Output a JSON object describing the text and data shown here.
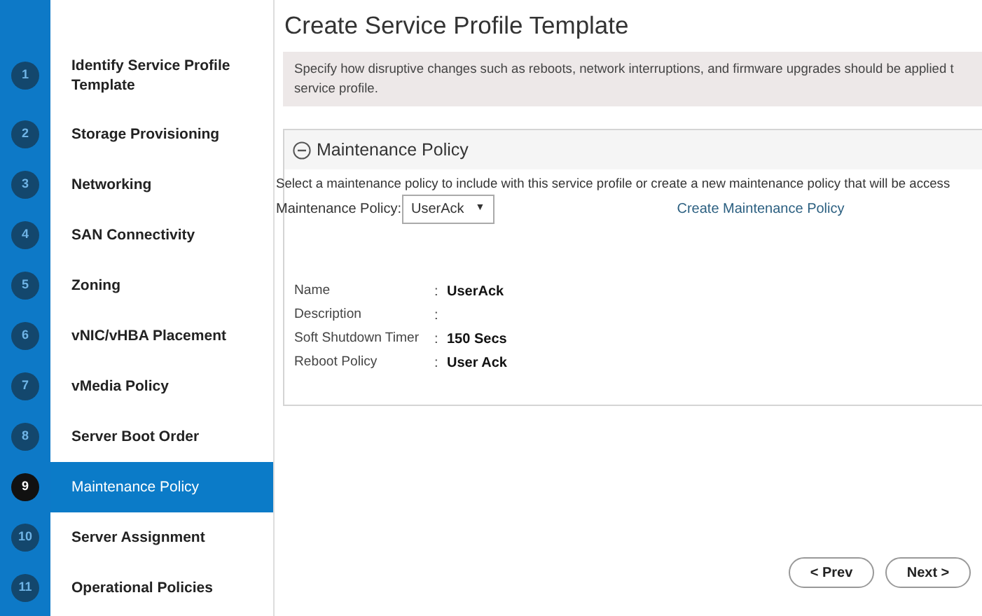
{
  "steps": [
    {
      "number": "1",
      "label": "Identify Service Profile Template",
      "selected": false
    },
    {
      "number": "2",
      "label": "Storage Provisioning",
      "selected": false
    },
    {
      "number": "3",
      "label": "Networking",
      "selected": false
    },
    {
      "number": "4",
      "label": "SAN Connectivity",
      "selected": false
    },
    {
      "number": "5",
      "label": "Zoning",
      "selected": false
    },
    {
      "number": "6",
      "label": "vNIC/vHBA Placement",
      "selected": false
    },
    {
      "number": "7",
      "label": "vMedia Policy",
      "selected": false
    },
    {
      "number": "8",
      "label": "Server Boot Order",
      "selected": false
    },
    {
      "number": "9",
      "label": "Maintenance Policy",
      "selected": true
    },
    {
      "number": "10",
      "label": "Server Assignment",
      "selected": false
    },
    {
      "number": "11",
      "label": "Operational Policies",
      "selected": false
    }
  ],
  "title": "Create Service Profile Template",
  "info_lines": [
    "Specify how disruptive changes such as reboots, network interruptions, and firmware upgrades should be applied t",
    "service profile."
  ],
  "panel": {
    "title": "Maintenance Policy",
    "expanded": true,
    "intro": "Select a maintenance policy to include with this service profile or create a new maintenance policy that will be access",
    "policy_label": "Maintenance Policy:",
    "policy_value": "UserAck",
    "caret": "▼",
    "create_link": "Create Maintenance Policy",
    "details": [
      {
        "label": "Name",
        "separator": ":",
        "value": "UserAck"
      },
      {
        "label": "Description",
        "separator": ":"
      },
      {
        "label": "Soft Shutdown Timer",
        "separator": ":",
        "value": "150 Secs"
      },
      {
        "label": "Reboot Policy",
        "separator": ":",
        "value": "User Ack"
      }
    ]
  },
  "buttons": [
    "< Prev",
    "Next >"
  ]
}
